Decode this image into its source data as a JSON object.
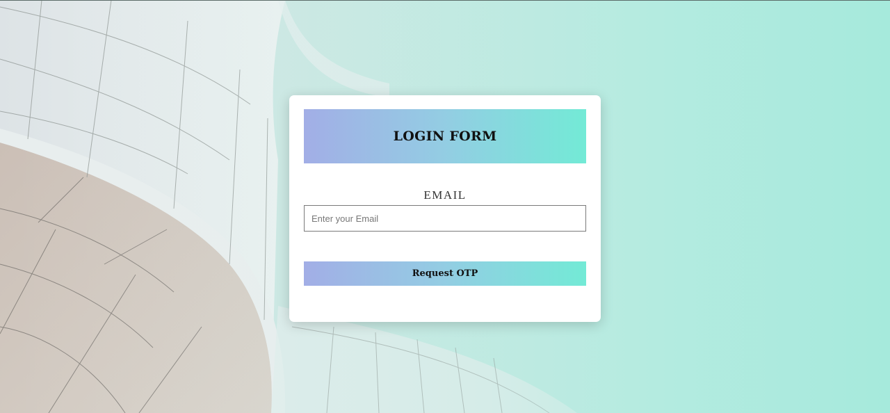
{
  "login_form": {
    "title": "LOGIN FORM",
    "email_label": "EMAIL",
    "email_placeholder": "Enter your Email",
    "email_value": "",
    "submit_label": "Request OTP"
  },
  "colors": {
    "gradient_start": "#a2aee6",
    "gradient_end": "#73ead6",
    "background_tint": "#a6eadc"
  }
}
